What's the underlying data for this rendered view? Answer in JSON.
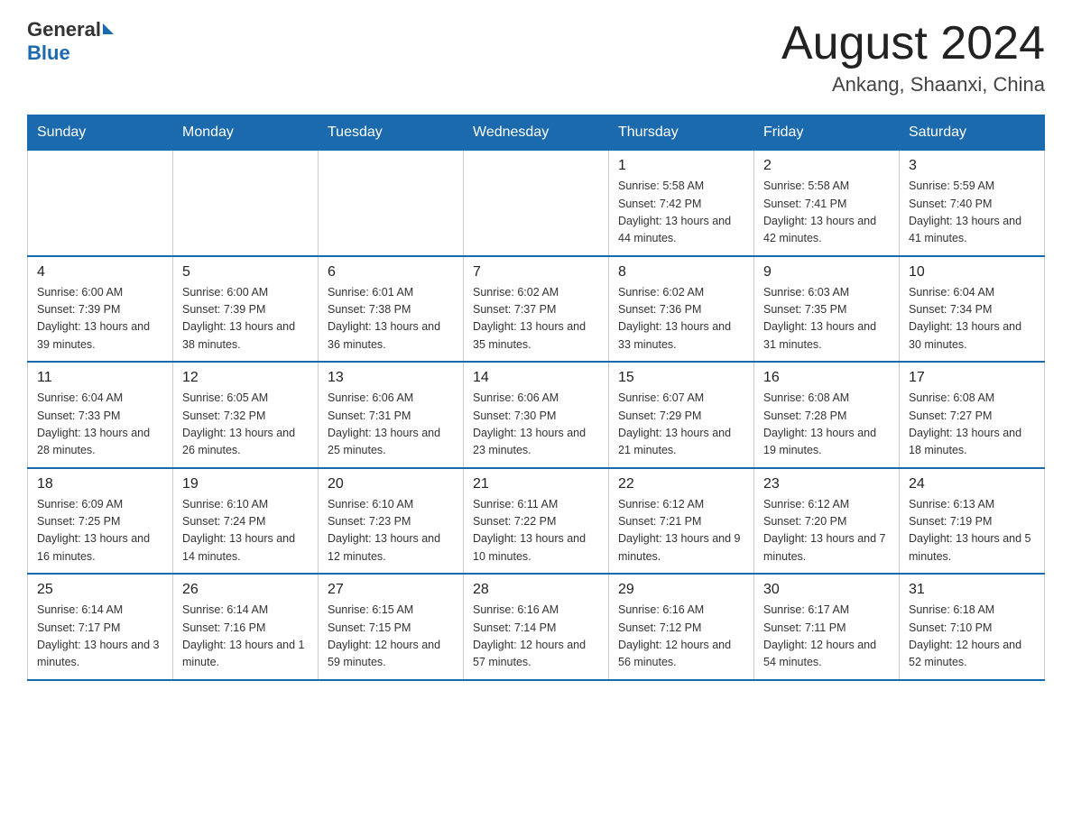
{
  "header": {
    "logo_general": "General",
    "logo_blue": "Blue",
    "month_title": "August 2024",
    "location": "Ankang, Shaanxi, China"
  },
  "days_of_week": [
    "Sunday",
    "Monday",
    "Tuesday",
    "Wednesday",
    "Thursday",
    "Friday",
    "Saturday"
  ],
  "weeks": [
    {
      "days": [
        {
          "number": "",
          "info": ""
        },
        {
          "number": "",
          "info": ""
        },
        {
          "number": "",
          "info": ""
        },
        {
          "number": "",
          "info": ""
        },
        {
          "number": "1",
          "info": "Sunrise: 5:58 AM\nSunset: 7:42 PM\nDaylight: 13 hours and 44 minutes."
        },
        {
          "number": "2",
          "info": "Sunrise: 5:58 AM\nSunset: 7:41 PM\nDaylight: 13 hours and 42 minutes."
        },
        {
          "number": "3",
          "info": "Sunrise: 5:59 AM\nSunset: 7:40 PM\nDaylight: 13 hours and 41 minutes."
        }
      ]
    },
    {
      "days": [
        {
          "number": "4",
          "info": "Sunrise: 6:00 AM\nSunset: 7:39 PM\nDaylight: 13 hours and 39 minutes."
        },
        {
          "number": "5",
          "info": "Sunrise: 6:00 AM\nSunset: 7:39 PM\nDaylight: 13 hours and 38 minutes."
        },
        {
          "number": "6",
          "info": "Sunrise: 6:01 AM\nSunset: 7:38 PM\nDaylight: 13 hours and 36 minutes."
        },
        {
          "number": "7",
          "info": "Sunrise: 6:02 AM\nSunset: 7:37 PM\nDaylight: 13 hours and 35 minutes."
        },
        {
          "number": "8",
          "info": "Sunrise: 6:02 AM\nSunset: 7:36 PM\nDaylight: 13 hours and 33 minutes."
        },
        {
          "number": "9",
          "info": "Sunrise: 6:03 AM\nSunset: 7:35 PM\nDaylight: 13 hours and 31 minutes."
        },
        {
          "number": "10",
          "info": "Sunrise: 6:04 AM\nSunset: 7:34 PM\nDaylight: 13 hours and 30 minutes."
        }
      ]
    },
    {
      "days": [
        {
          "number": "11",
          "info": "Sunrise: 6:04 AM\nSunset: 7:33 PM\nDaylight: 13 hours and 28 minutes."
        },
        {
          "number": "12",
          "info": "Sunrise: 6:05 AM\nSunset: 7:32 PM\nDaylight: 13 hours and 26 minutes."
        },
        {
          "number": "13",
          "info": "Sunrise: 6:06 AM\nSunset: 7:31 PM\nDaylight: 13 hours and 25 minutes."
        },
        {
          "number": "14",
          "info": "Sunrise: 6:06 AM\nSunset: 7:30 PM\nDaylight: 13 hours and 23 minutes."
        },
        {
          "number": "15",
          "info": "Sunrise: 6:07 AM\nSunset: 7:29 PM\nDaylight: 13 hours and 21 minutes."
        },
        {
          "number": "16",
          "info": "Sunrise: 6:08 AM\nSunset: 7:28 PM\nDaylight: 13 hours and 19 minutes."
        },
        {
          "number": "17",
          "info": "Sunrise: 6:08 AM\nSunset: 7:27 PM\nDaylight: 13 hours and 18 minutes."
        }
      ]
    },
    {
      "days": [
        {
          "number": "18",
          "info": "Sunrise: 6:09 AM\nSunset: 7:25 PM\nDaylight: 13 hours and 16 minutes."
        },
        {
          "number": "19",
          "info": "Sunrise: 6:10 AM\nSunset: 7:24 PM\nDaylight: 13 hours and 14 minutes."
        },
        {
          "number": "20",
          "info": "Sunrise: 6:10 AM\nSunset: 7:23 PM\nDaylight: 13 hours and 12 minutes."
        },
        {
          "number": "21",
          "info": "Sunrise: 6:11 AM\nSunset: 7:22 PM\nDaylight: 13 hours and 10 minutes."
        },
        {
          "number": "22",
          "info": "Sunrise: 6:12 AM\nSunset: 7:21 PM\nDaylight: 13 hours and 9 minutes."
        },
        {
          "number": "23",
          "info": "Sunrise: 6:12 AM\nSunset: 7:20 PM\nDaylight: 13 hours and 7 minutes."
        },
        {
          "number": "24",
          "info": "Sunrise: 6:13 AM\nSunset: 7:19 PM\nDaylight: 13 hours and 5 minutes."
        }
      ]
    },
    {
      "days": [
        {
          "number": "25",
          "info": "Sunrise: 6:14 AM\nSunset: 7:17 PM\nDaylight: 13 hours and 3 minutes."
        },
        {
          "number": "26",
          "info": "Sunrise: 6:14 AM\nSunset: 7:16 PM\nDaylight: 13 hours and 1 minute."
        },
        {
          "number": "27",
          "info": "Sunrise: 6:15 AM\nSunset: 7:15 PM\nDaylight: 12 hours and 59 minutes."
        },
        {
          "number": "28",
          "info": "Sunrise: 6:16 AM\nSunset: 7:14 PM\nDaylight: 12 hours and 57 minutes."
        },
        {
          "number": "29",
          "info": "Sunrise: 6:16 AM\nSunset: 7:12 PM\nDaylight: 12 hours and 56 minutes."
        },
        {
          "number": "30",
          "info": "Sunrise: 6:17 AM\nSunset: 7:11 PM\nDaylight: 12 hours and 54 minutes."
        },
        {
          "number": "31",
          "info": "Sunrise: 6:18 AM\nSunset: 7:10 PM\nDaylight: 12 hours and 52 minutes."
        }
      ]
    }
  ]
}
